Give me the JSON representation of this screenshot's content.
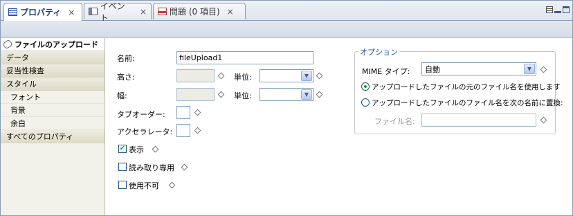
{
  "tabs": [
    {
      "label": "プロパティ",
      "active": true
    },
    {
      "label": "イベント",
      "active": false
    },
    {
      "label": "問題 (0 項目)",
      "active": false
    }
  ],
  "close_glyph": "×",
  "leftnav": {
    "items": [
      {
        "label": "ファイルのアップロード",
        "selected": true
      },
      {
        "label": "データ"
      },
      {
        "label": "妥当性検査"
      },
      {
        "label": "スタイル"
      },
      {
        "label": "フォント",
        "sub": true
      },
      {
        "label": "背景",
        "sub": true
      },
      {
        "label": "余白",
        "sub": true
      },
      {
        "label": "すべてのプロパティ"
      }
    ]
  },
  "form": {
    "name_label": "名前:",
    "name_value": "fileUpload1",
    "height_label": "高さ:",
    "width_label": "幅:",
    "unit_label": "単位:",
    "tab_order_label": "タブオーダー:",
    "accelerator_label": "アクセラレータ:",
    "visible_label": "表示",
    "visible_checked": true,
    "readonly_label": "読み取り専用",
    "readonly_checked": false,
    "disabled_label": "使用不可",
    "disabled_checked": false,
    "check_glyph": "✔"
  },
  "options": {
    "title": "オプション",
    "mime_label": "MIME タイプ:",
    "mime_value": "自動",
    "radio1_label": "アップロードしたファイルの元のファイル名を使用します",
    "radio2_label": "アップロードしたファイルのファイル名を次の名前に置換:",
    "filename_label": "ファイル名:",
    "selected_radio": 1
  },
  "colors": {
    "accent": "#1e4ea6",
    "check": "#21a121",
    "border": "#8a9bb4"
  }
}
